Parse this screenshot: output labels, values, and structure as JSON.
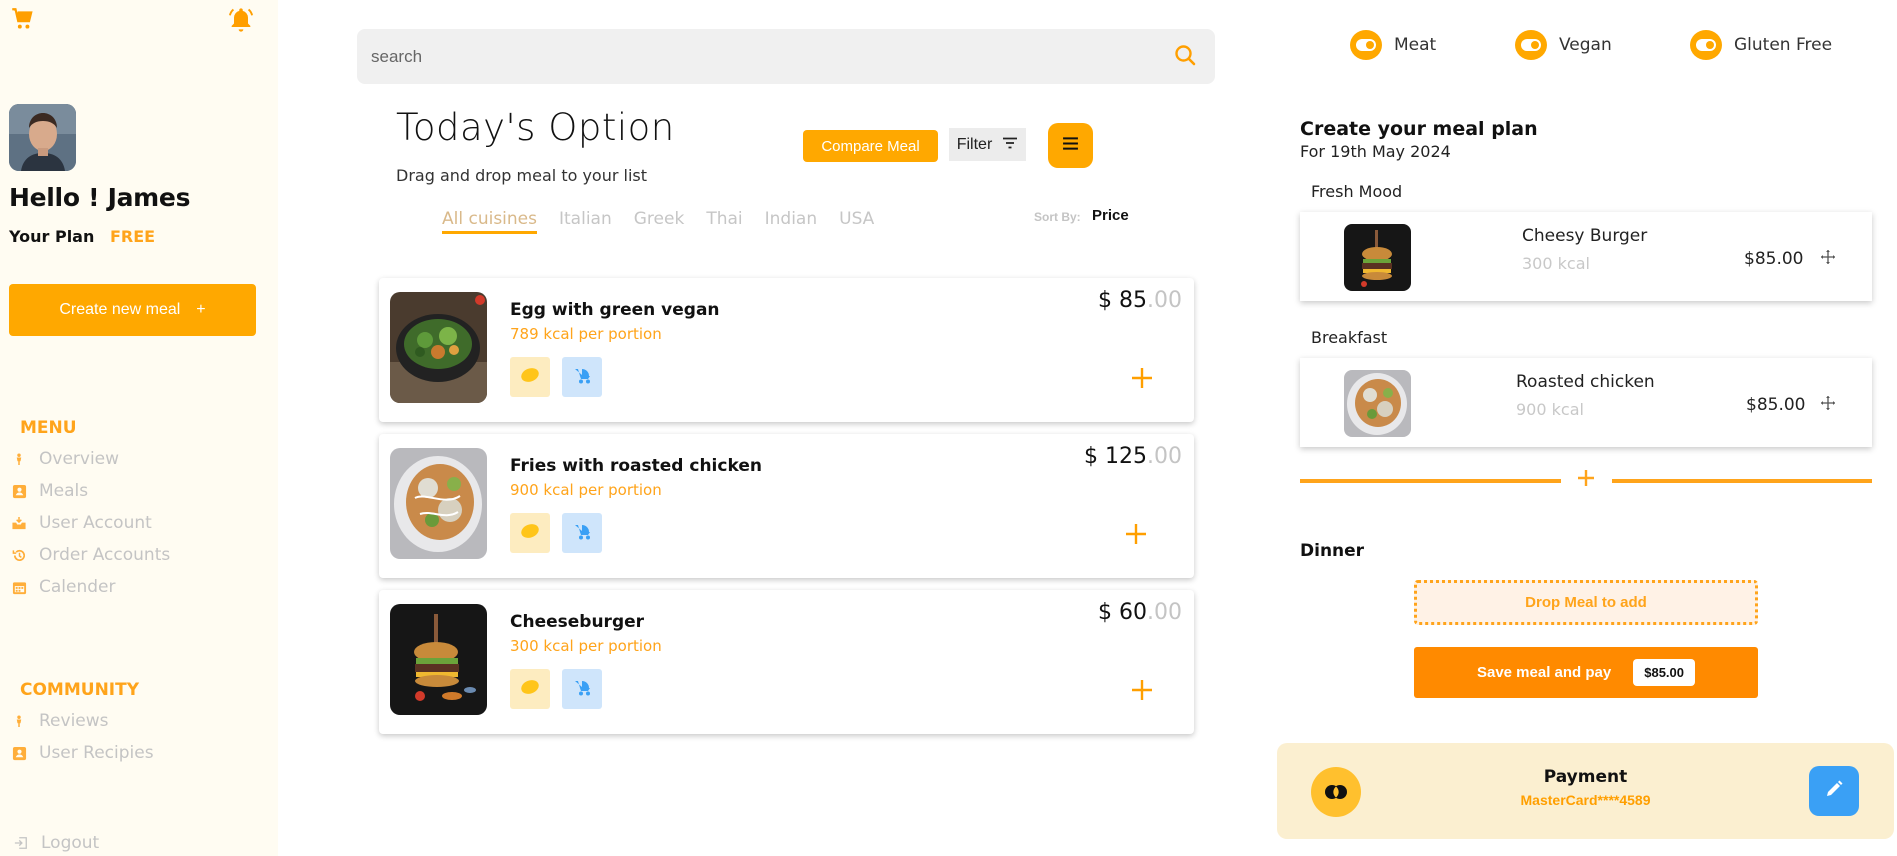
{
  "sidebar": {
    "cart_icon": "cart-icon",
    "bell_icon": "bell-icon",
    "greeting": "Hello ! James",
    "plan_label": "Your Plan",
    "plan_value": "FREE",
    "create_button": "Create new meal",
    "create_button_icon": "+",
    "menu_title": "MENU",
    "menu_items": [
      {
        "label": "Overview",
        "icon": "person-icon"
      },
      {
        "label": "Meals",
        "icon": "contact-book-icon"
      },
      {
        "label": "User Account",
        "icon": "inbox-icon"
      },
      {
        "label": "Order Accounts",
        "icon": "history-icon"
      },
      {
        "label": "Calender",
        "icon": "calendar-icon"
      }
    ],
    "community_title": "COMMUNITY",
    "community_items": [
      {
        "label": "Reviews",
        "icon": "person-icon"
      },
      {
        "label": "User Recipies",
        "icon": "contact-book-icon"
      }
    ],
    "logout": "Logout"
  },
  "main": {
    "search_placeholder": "search",
    "title": "Today's Option",
    "subtitle": "Drag and drop meal to your list",
    "compare_button": "Compare Meal",
    "filter_button": "Filter",
    "cuisines": [
      "All cuisines",
      "Italian",
      "Greek",
      "Thai",
      "Indian",
      "USA"
    ],
    "active_cuisine": "All cuisines",
    "sort_label": "Sort By:",
    "sort_value": "Price",
    "meals": [
      {
        "name": "Egg with green vegan",
        "kcal": "789 kcal per portion",
        "price_main": "$ 85",
        "price_cents": ".00"
      },
      {
        "name": "Fries with roasted chicken",
        "kcal": "900 kcal per portion",
        "price_main": "$ 125",
        "price_cents": ".00"
      },
      {
        "name": "Cheeseburger",
        "kcal": "300 kcal per portion",
        "price_main": "$ 60",
        "price_cents": ".00"
      }
    ]
  },
  "right": {
    "toggles": [
      "Meat",
      "Vegan",
      "Gluten Free"
    ],
    "plan_title": "Create your meal plan",
    "plan_date": "For 19th May 2024",
    "sections": [
      {
        "label": "Fresh Mood",
        "name": "Cheesy Burger",
        "kcal": "300 kcal",
        "price": "$85.00"
      },
      {
        "label": "Breakfast",
        "name": "Roasted chicken",
        "kcal": "900 kcal",
        "price": "$85.00"
      }
    ],
    "dinner_label": "Dinner",
    "drop_text": "Drop Meal to add",
    "save_button": "Save meal and pay",
    "save_amount": "$85.00",
    "payment_title": "Payment",
    "payment_card": "MasterCard****4589"
  },
  "colors": {
    "accent": "#ffa800",
    "accent_dark": "#ff8a00",
    "sidebar_bg": "#fffcf2",
    "payment_bg": "#fbefd0",
    "edit_blue": "#3aa0f5"
  }
}
